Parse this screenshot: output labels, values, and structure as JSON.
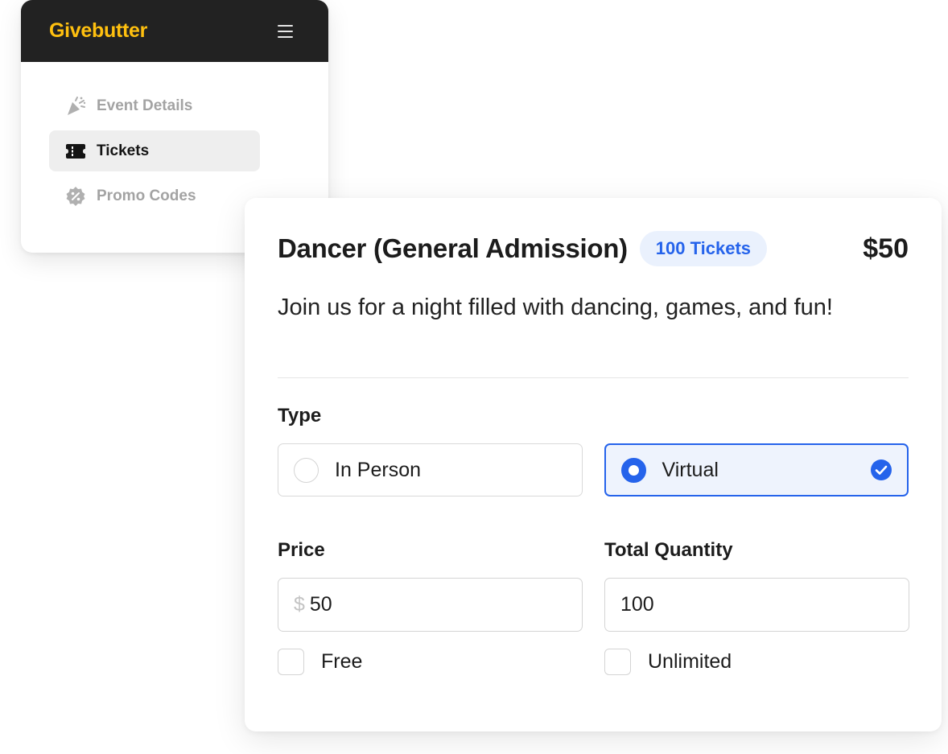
{
  "sidebar": {
    "logo": "Givebutter",
    "logo_color": "#ffc00f",
    "header_bg": "#222222",
    "items": [
      {
        "label": "Event Details",
        "icon": "party-popper-icon",
        "active": false
      },
      {
        "label": "Tickets",
        "icon": "ticket-icon",
        "active": true
      },
      {
        "label": "Promo Codes",
        "icon": "percent-badge-icon",
        "active": false
      }
    ]
  },
  "ticket": {
    "title": "Dancer (General Admission)",
    "badge": "100 Tickets",
    "price": "$50",
    "description": "Join us for a night filled with dancing, games, and fun!"
  },
  "form": {
    "type_label": "Type",
    "type_options": [
      {
        "label": "In Person",
        "selected": false
      },
      {
        "label": "Virtual",
        "selected": true
      }
    ],
    "price_label": "Price",
    "price_currency": "$",
    "price_value": "50",
    "quantity_label": "Total Quantity",
    "quantity_value": "100",
    "free_label": "Free",
    "free_checked": false,
    "unlimited_label": "Unlimited",
    "unlimited_checked": false
  },
  "colors": {
    "accent": "#2563eb",
    "badge_bg": "#eaf1fd",
    "selected_bg": "#eef3fd"
  }
}
